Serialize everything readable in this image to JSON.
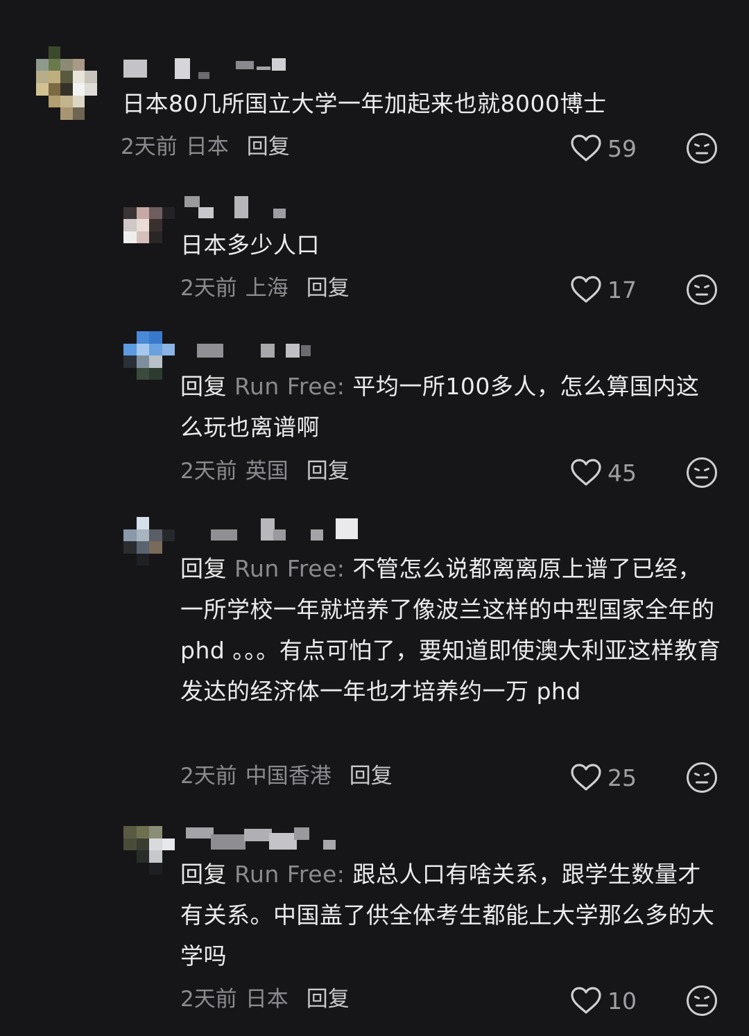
{
  "comments": [
    {
      "text": "日本80几所国立大学一年加起来也就8000博士",
      "time": "2天前",
      "location": "日本",
      "reply_label": "回复",
      "likes": "59"
    },
    {
      "text": "日本多少人口",
      "time": "2天前",
      "location": "上海",
      "reply_label": "回复",
      "likes": "17"
    },
    {
      "reply_prefix": "回复",
      "reply_to": "Run Free:",
      "text": "平均一所100多人，怎么算国内这么玩也离谱啊",
      "time": "2天前",
      "location": "英国",
      "reply_label": "回复",
      "likes": "45"
    },
    {
      "reply_prefix": "回复",
      "reply_to": "Run Free:",
      "text": "不管怎么说都离离原上谱了已经，一所学校一年就培养了像波兰这样的中型国家全年的 phd 。。。有点可怕了，要知道即使澳大利亚这样教育发达的经济体一年也才培养约一万 phd",
      "time": "2天前",
      "location": "中国香港",
      "reply_label": "回复",
      "likes": "25"
    },
    {
      "reply_prefix": "回复",
      "reply_to": "Run Free:",
      "text": "跟总人口有啥关系，跟学生数量才有关系。中国盖了供全体考生都能上大学那么多的大学吗",
      "time": "2天前",
      "location": "日本",
      "reply_label": "回复",
      "likes": "10"
    }
  ],
  "colors": {
    "background": "#161618",
    "text": "#ececee",
    "muted": "#8b8b90",
    "icon": "#d0d0d3"
  },
  "icons": {
    "like": "heart-outline-icon",
    "dislike": "frown-face-icon"
  }
}
